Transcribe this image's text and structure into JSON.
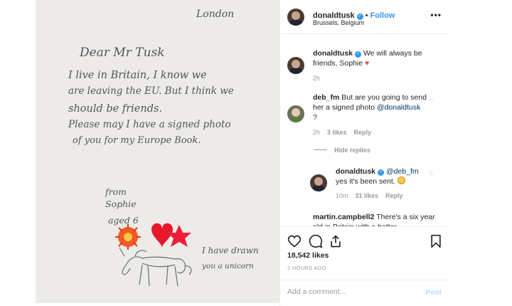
{
  "letter": {
    "city": "London",
    "greeting": "Dear Mr Tusk",
    "lines": [
      "I live in Britain, I know we",
      "are leaving the EU. But I think we",
      "should be friends.",
      "Please may I have a signed photo",
      "of you for my Europe Book."
    ],
    "from": "from",
    "name": "Sophie",
    "age": "aged 6",
    "drawn_line1": "I have drawn",
    "drawn_line2": "you a unicorn"
  },
  "header": {
    "username": "donaldtusk",
    "follow_label": "Follow",
    "location": "Brussels, Belgium"
  },
  "comments": [
    {
      "username": "donaldtusk",
      "text": "We will always be friends, Sophie",
      "time": "2h"
    },
    {
      "username": "deb_fm",
      "text": "But are you going to send her a signed photo",
      "mention": "@donaldtusk",
      "text_end": " ?",
      "time": "2h",
      "likes": "3 likes",
      "reply_label": "Reply"
    },
    {
      "username": "donaldtusk",
      "mention": "@deb_fm",
      "text": "yes it's been sent.",
      "time": "10m",
      "likes": "31 likes",
      "reply_label": "Reply"
    },
    {
      "username": "martin.campbell2",
      "text": "There's a six year old in Britain with a better"
    }
  ],
  "hide_replies_label": "Hide replies",
  "actions": {
    "likes": "18,542 likes",
    "timestamp": "2 HOURS AGO",
    "add_comment_placeholder": "Add a comment...",
    "post_label": "Post"
  },
  "icons": [
    "more-icon",
    "heart-icon",
    "comment-icon",
    "share-icon",
    "bookmark-icon",
    "verified-icon",
    "red-heart-emoji",
    "smile-emoji"
  ],
  "colors": {
    "link": "#3897f0",
    "muted": "#999999",
    "heart": "#ed4956"
  }
}
